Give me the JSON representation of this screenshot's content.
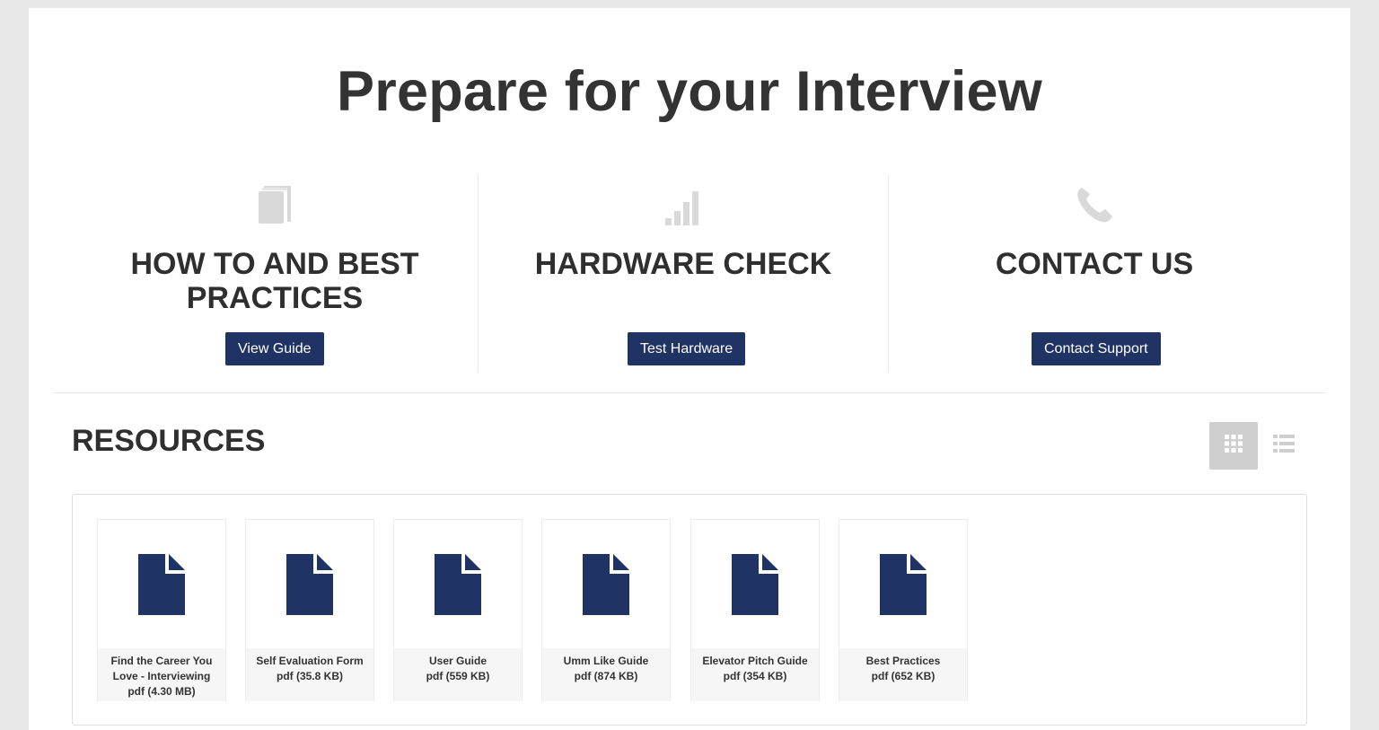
{
  "page": {
    "title": "Prepare for your Interview"
  },
  "sections": [
    {
      "title_line1": "HOW TO AND BEST",
      "title_line2": "PRACTICES",
      "icon": "book-icon",
      "button": "View Guide"
    },
    {
      "title_line1": "HARDWARE CHECK",
      "title_line2": "",
      "icon": "signal-bars-icon",
      "button": "Test Hardware"
    },
    {
      "title_line1": "CONTACT US",
      "title_line2": "",
      "icon": "phone-icon",
      "button": "Contact Support"
    }
  ],
  "resources": {
    "title": "RESOURCES",
    "view_modes": [
      "grid-view-icon",
      "list-view-icon"
    ],
    "active_view": "grid",
    "items": [
      {
        "line1": "Find the Career You",
        "line2": "Love - Interviewing",
        "meta": "pdf (4.30 MB)"
      },
      {
        "line1": "Self Evaluation Form",
        "line2": "",
        "meta": "pdf (35.8 KB)"
      },
      {
        "line1": "User Guide",
        "line2": "",
        "meta": "pdf (559 KB)"
      },
      {
        "line1": "Umm Like Guide",
        "line2": "",
        "meta": "pdf (874 KB)"
      },
      {
        "line1": "Elevator Pitch Guide",
        "line2": "",
        "meta": "pdf (354 KB)"
      },
      {
        "line1": "Best Practices",
        "line2": "",
        "meta": "pdf (652 KB)"
      }
    ]
  },
  "colors": {
    "accent": "#1f3364",
    "icon_gray": "#d9d9d9",
    "background": "#e8e8e8"
  }
}
